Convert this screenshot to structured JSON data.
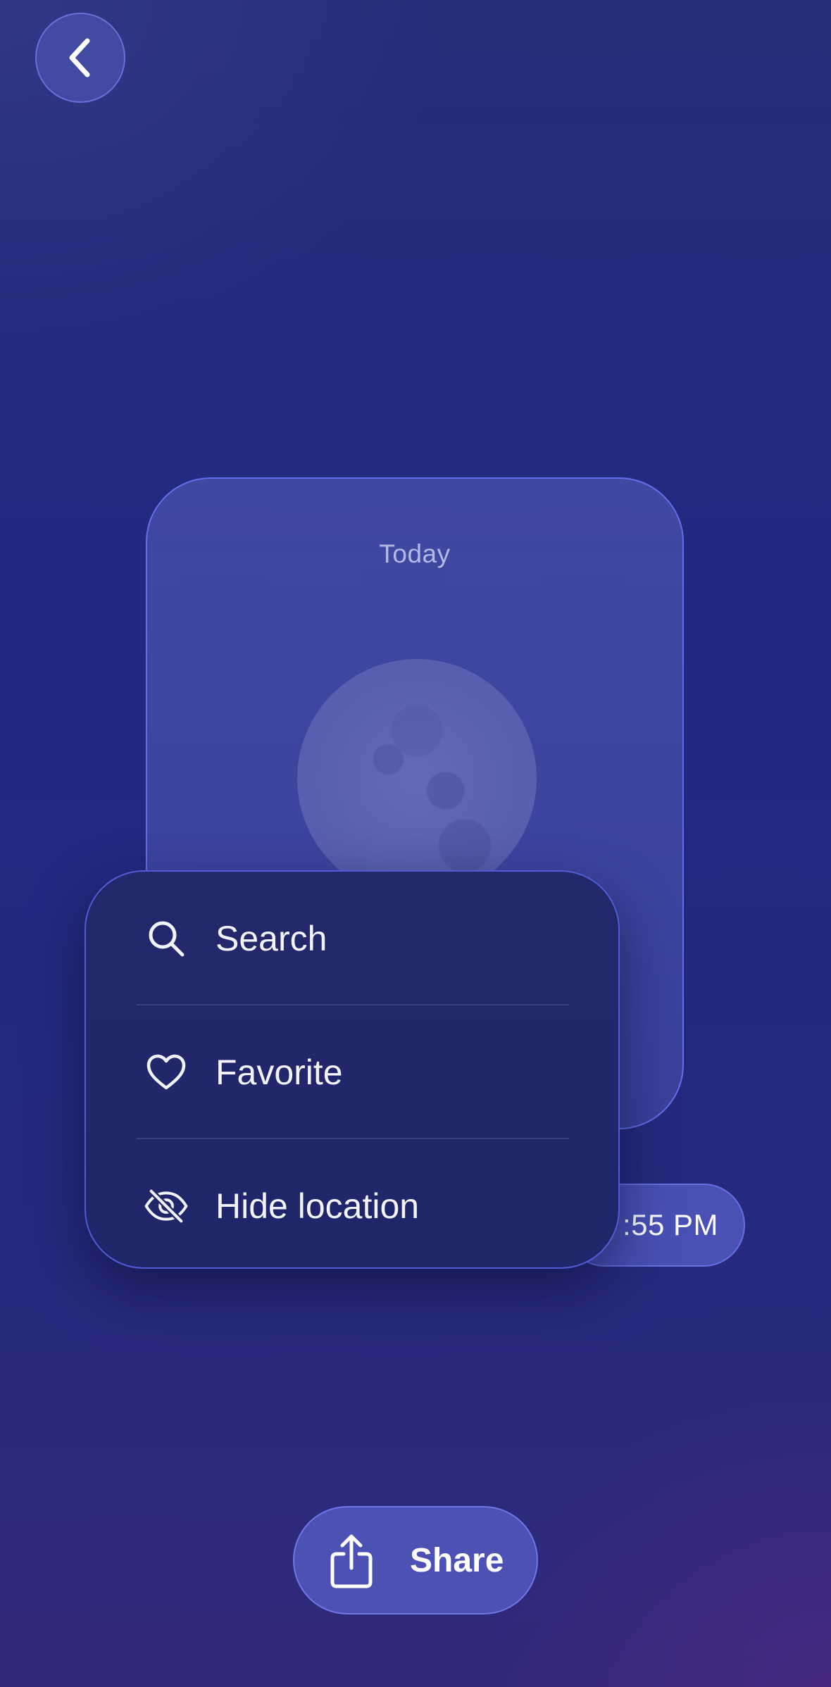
{
  "nav": {
    "back_icon": "chevron-left-icon"
  },
  "widget": {
    "day_label": "Today",
    "image": "moon"
  },
  "time_pill": {
    "text": ":55 PM"
  },
  "context_menu": {
    "items": [
      {
        "label": "Search",
        "icon": "search-icon"
      },
      {
        "label": "Favorite",
        "icon": "heart-icon"
      },
      {
        "label": "Hide location",
        "icon": "eye-slash-icon"
      }
    ]
  },
  "share": {
    "label": "Share",
    "icon": "share-icon"
  },
  "colors": {
    "background": "#232a7e",
    "accent_border": "#6a73f0",
    "menu_background": "#21276a",
    "text": "#ffffff"
  }
}
